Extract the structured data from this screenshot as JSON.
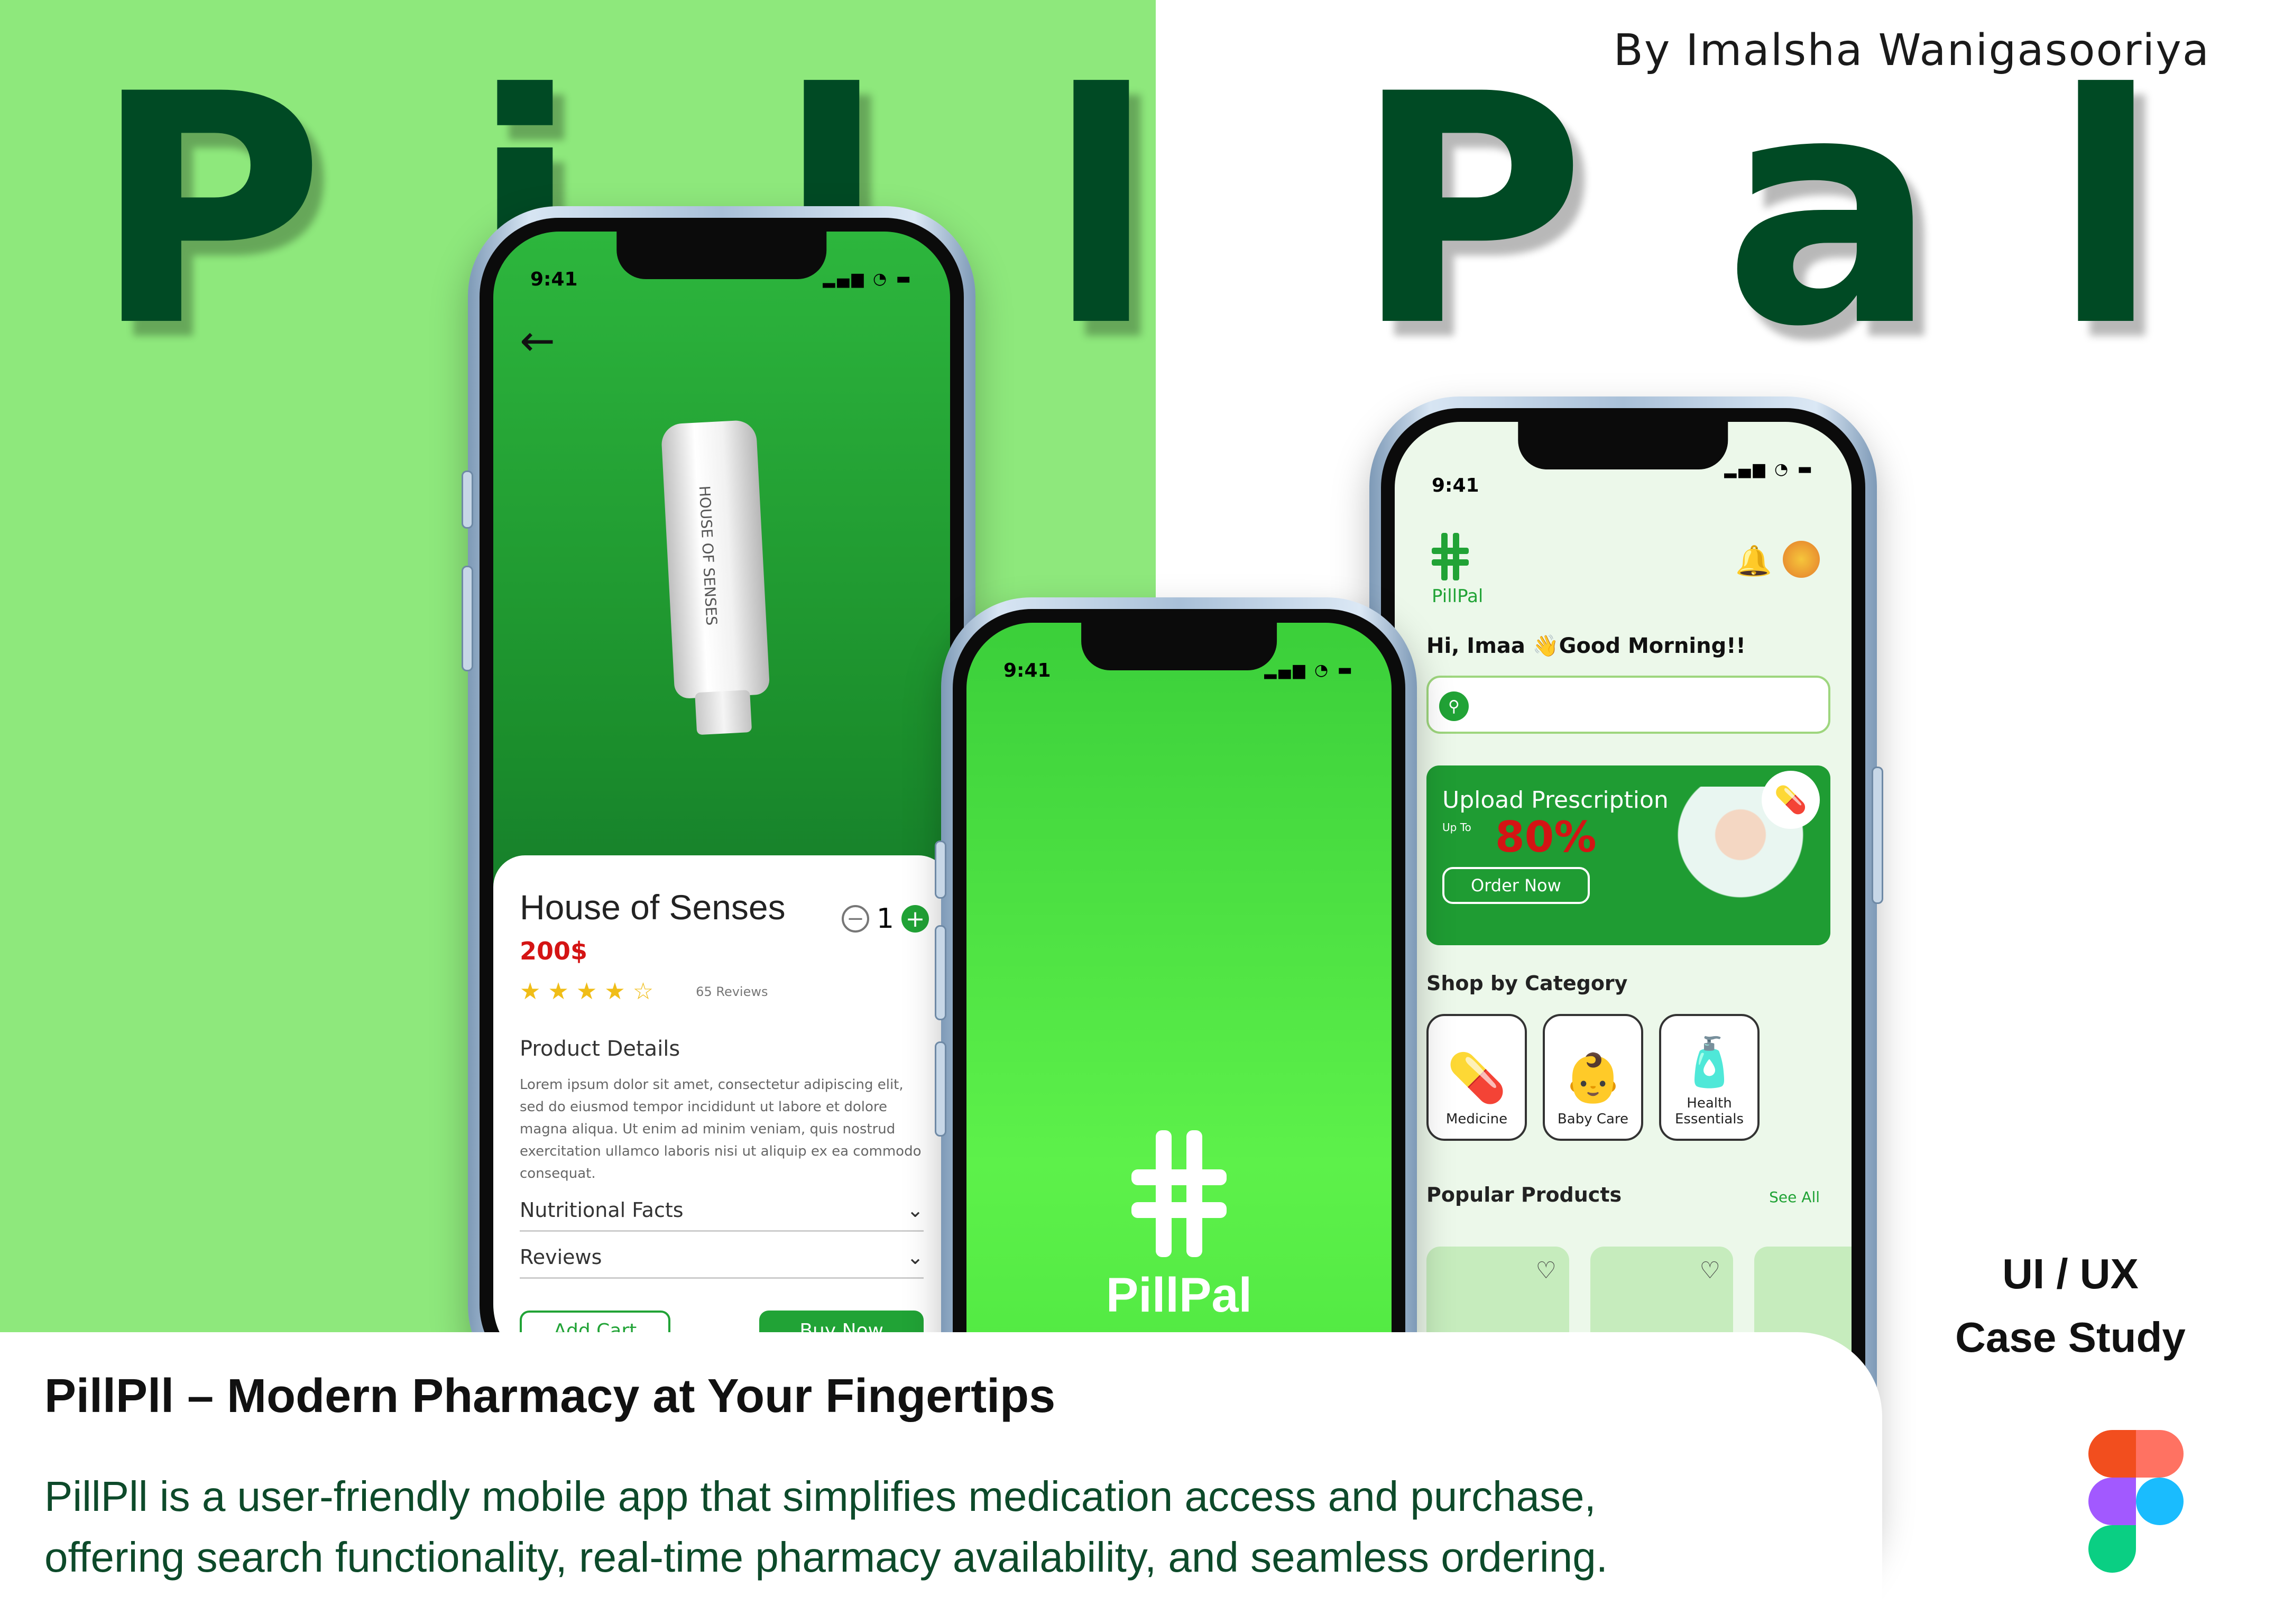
{
  "author": "By Imalsha Wanigasooriya",
  "brand_letters": [
    "P",
    "i",
    "l",
    "l",
    "P",
    "a",
    "l"
  ],
  "colors": {
    "brand_green": "#004a24",
    "panel_green": "#8ee87c",
    "accent": "#21a336",
    "price_red": "#d41414"
  },
  "phone_detail": {
    "time": "9:41",
    "product_name": "House of Senses",
    "tube_label": "HOUSE OF SENSES",
    "price": "200$",
    "quantity": "1",
    "stars": "★ ★ ★ ★ ☆",
    "review_count": "65 Reviews",
    "product_details_heading": "Product Details",
    "description": "Lorem ipsum dolor sit amet, consectetur adipiscing elit, sed do eiusmod tempor incididunt ut labore et dolore magna aliqua. Ut enim ad minim veniam, quis nostrud exercitation ullamco laboris nisi ut aliquip ex ea commodo consequat.",
    "nutritional_facts": "Nutritional Facts",
    "reviews": "Reviews",
    "add_cart": "Add Cart",
    "buy_now": "Buy Now"
  },
  "phone_splash": {
    "time": "9:41",
    "app_name": "PillPal"
  },
  "phone_home": {
    "time": "9:41",
    "logo_text": "PillPal",
    "greeting": "Hi, Imaa 👋Good Morning!!",
    "promo_title": "Upload Prescription",
    "promo_upto": "Up To",
    "promo_discount": "80%",
    "promo_button": "Order Now",
    "shop_heading": "Shop by Category",
    "categories": [
      {
        "label": "Medicine",
        "icon": "💊"
      },
      {
        "label": "Baby Care",
        "icon": "👶"
      },
      {
        "label": "Health Essentials",
        "icon": "🧴"
      }
    ],
    "popular_heading": "Popular Products",
    "see_all": "See All"
  },
  "headline": "PillPll – Modern Pharmacy at Your Fingertips",
  "description_lines": [
    "PillPll is a user-friendly mobile app that simplifies medication access and purchase,",
    "offering search functionality, real-time pharmacy availability, and seamless ordering."
  ],
  "tag_line1": "UI / UX",
  "tag_line2": "Case Study"
}
